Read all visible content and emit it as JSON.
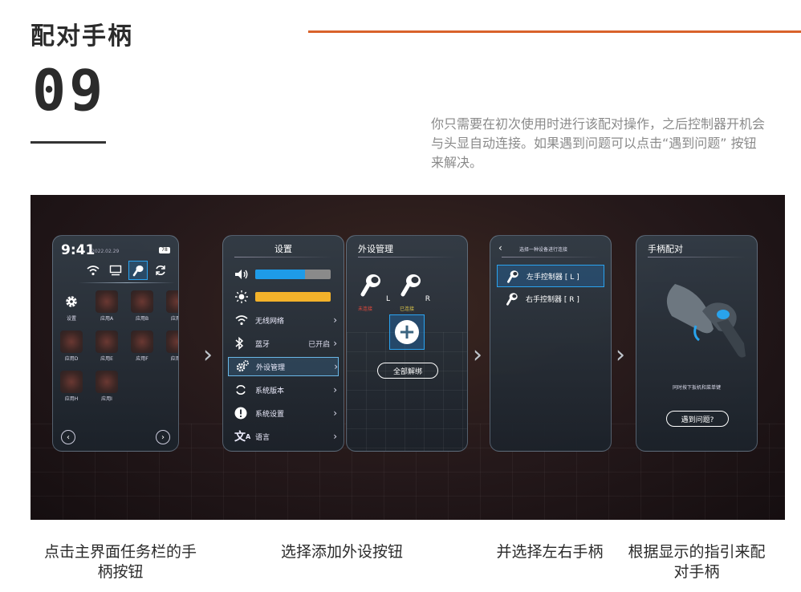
{
  "header": {
    "title": "配对手柄",
    "step_number": "09",
    "description": "你只需要在初次使用时进行该配对操作，之后控制器开机会与头显自动连接。如果遇到问题可以点击“遇到问题” 按钮来解决。",
    "accent_color": "#d9622b"
  },
  "screen1": {
    "time": "9:41",
    "date": "2022.02.29",
    "battery": "78",
    "taskbar_icons": [
      "wifi-icon",
      "monitor-icon",
      "controller-icon",
      "sync-icon"
    ],
    "selected_taskbar_index": 2,
    "apps": [
      "设置",
      "应用A",
      "应用B",
      "应用C",
      "应用D",
      "应用E",
      "应用F",
      "应用G",
      "应用H",
      "应用I"
    ]
  },
  "screen2": {
    "title": "设置",
    "volume_level": 0.66,
    "brightness_level": 1.0,
    "volume_color": "#1e9be8",
    "brightness_color": "#f3b22a",
    "items": [
      {
        "label": "无线网络",
        "value": ""
      },
      {
        "label": "蓝牙",
        "value": "已开启"
      },
      {
        "label": "外设管理",
        "value": ""
      },
      {
        "label": "系统版本",
        "value": ""
      },
      {
        "label": "系统设置",
        "value": ""
      },
      {
        "label": "语言",
        "value": ""
      }
    ]
  },
  "screen3": {
    "title": "外设管理",
    "left_label": "L",
    "right_label": "R",
    "left_status": "未连接",
    "right_status": "已连接",
    "unbind_all": "全部解绑"
  },
  "screen4": {
    "title": "选择一种设备进行连接",
    "options": [
      "左手控制器 [ L ]",
      "右手控制器 [ R ]"
    ]
  },
  "screen5": {
    "title": "手柄配对",
    "hint": "同时按下扳机和菜单键",
    "help_button": "遇到问题?"
  },
  "captions": [
    "点击主界面任务栏的手柄按钮",
    "选择添加外设按钮",
    "并选择左右手柄",
    "根据显示的指引来配对手柄"
  ]
}
